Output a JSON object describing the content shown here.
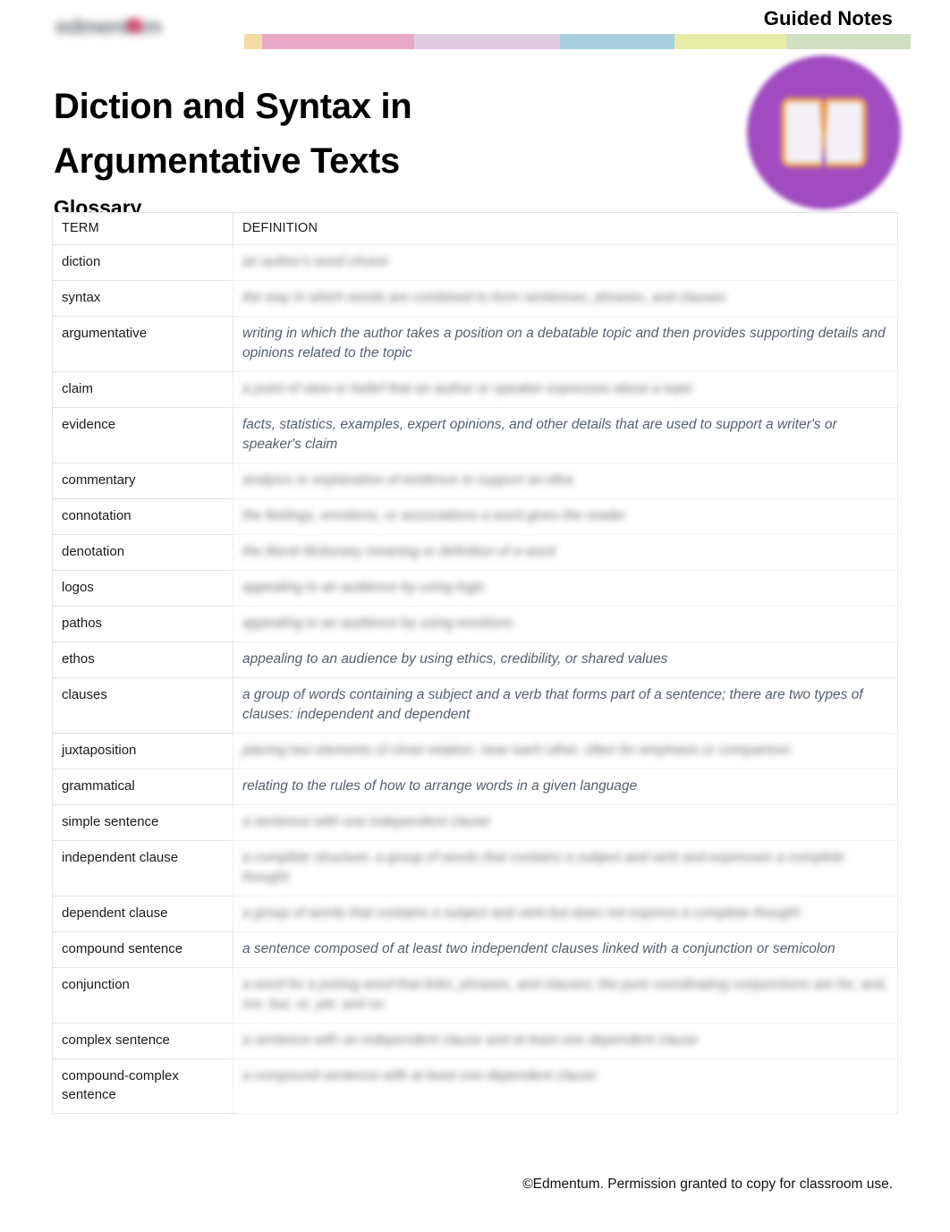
{
  "header": {
    "guided_notes_label": "Guided Notes",
    "logo_text": "edmentum",
    "colorbar_colors": [
      "#f3dca3",
      "#e9a8c4",
      "#e2cce4",
      "#a8cede",
      "#e6eda8",
      "#cfe0c3"
    ]
  },
  "title": "Diction and Syntax in Argumentative Texts",
  "badge": {
    "icon": "open-book-icon",
    "circle_color": "#a04cc0",
    "book_outline_color": "#e8a05c"
  },
  "glossary": {
    "heading": "Glossary",
    "columns": [
      "TERM",
      "DEFINITION"
    ],
    "rows": [
      {
        "term": "diction",
        "definition": "an author's word choice",
        "redacted": true
      },
      {
        "term": "syntax",
        "definition": "the way in which words are combined to form sentences, phrases, and clauses",
        "redacted": true
      },
      {
        "term": "argumentative",
        "definition": "writing in which the author takes a position on a debatable topic and then provides supporting details and opinions related to the topic",
        "redacted": false
      },
      {
        "term": "claim",
        "definition": "a point of view or belief that an author or speaker expresses about a topic",
        "redacted": true
      },
      {
        "term": "evidence",
        "definition": "facts, statistics, examples, expert opinions, and other details that are used to support a writer's or speaker's claim",
        "redacted": false
      },
      {
        "term": "commentary",
        "definition": "analysis or explanation of evidence to support an idea",
        "redacted": true
      },
      {
        "term": "connotation",
        "definition": "the feelings, emotions, or associations a word gives the reader",
        "redacted": true
      },
      {
        "term": "denotation",
        "definition": "the literal dictionary meaning or definition of a word",
        "redacted": true
      },
      {
        "term": "logos",
        "definition": "appealing to an audience by using logic",
        "redacted": true
      },
      {
        "term": "pathos",
        "definition": "appealing to an audience by using emotions",
        "redacted": true
      },
      {
        "term": "ethos",
        "definition": "appealing to an audience by using ethics, credibility, or shared values",
        "redacted": false
      },
      {
        "term": "clauses",
        "definition": "a group of words containing a subject and a verb that forms part of a sentence; there are two types of clauses: independent and dependent",
        "redacted": false
      },
      {
        "term": "juxtaposition",
        "definition": "placing two elements of close relation, near each other, often for emphasis or comparison",
        "redacted": true
      },
      {
        "term": "grammatical",
        "definition": "relating to the rules of how to arrange words in a given language",
        "redacted": false
      },
      {
        "term": "simple sentence",
        "definition": "a sentence with one independent clause",
        "redacted": true
      },
      {
        "term": "independent clause",
        "definition": "a complete structure; a group of words that contains a subject and verb and expresses a complete thought",
        "redacted": true
      },
      {
        "term": "dependent clause",
        "definition": "a group of words that contains a subject and verb but does not express a complete thought",
        "redacted": true
      },
      {
        "term": "compound sentence",
        "definition": "a sentence composed of at least two independent clauses linked with a conjunction or semicolon",
        "redacted": false
      },
      {
        "term": "conjunction",
        "definition": "a word for a joining word that links, phrases, and clauses; the pure coordinating conjunctions are for, and, nor, but, or, yet, and so",
        "redacted": true
      },
      {
        "term": "complex sentence",
        "definition": "a sentence with an independent clause and at least one dependent clause",
        "redacted": true
      },
      {
        "term": "compound-complex sentence",
        "definition": "a compound sentence with at least one dependent clause",
        "redacted": true
      }
    ]
  },
  "footer": {
    "copyright": "©Edmentum. Permission granted to copy for classroom use."
  }
}
